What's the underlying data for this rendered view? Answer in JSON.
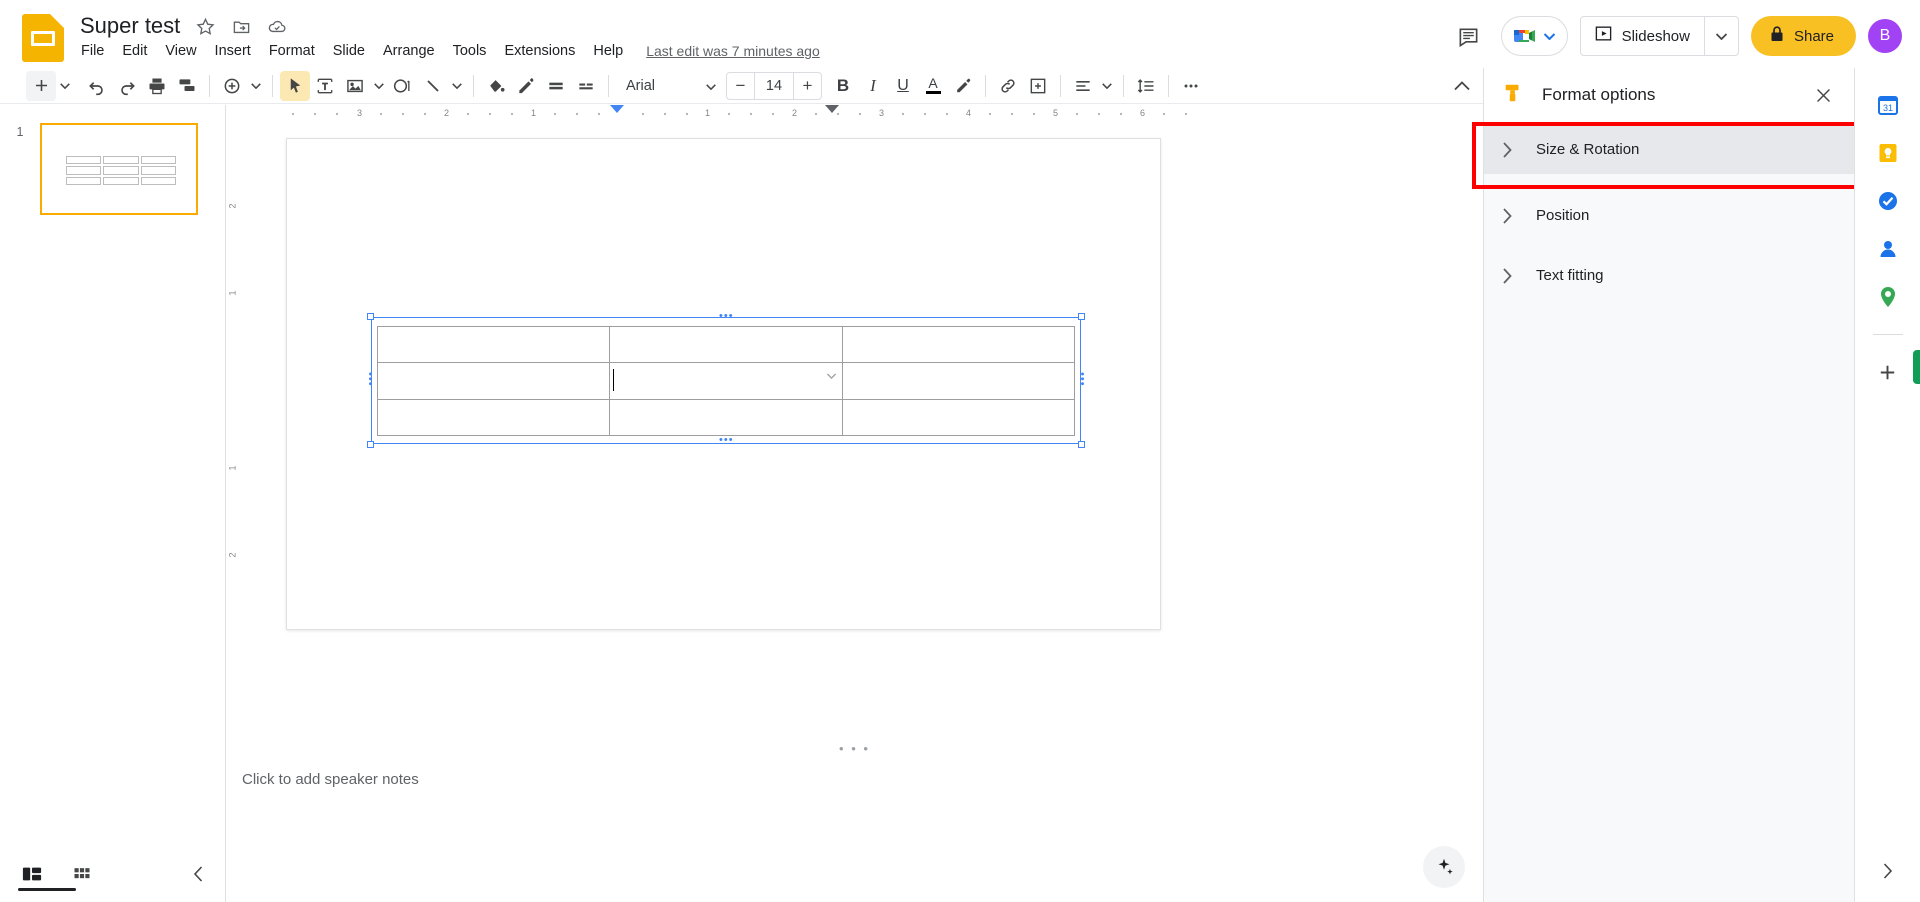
{
  "app": {
    "logo_icon": "slides-logo-icon",
    "title": "Super test",
    "title_icons": [
      "star-icon",
      "move-to-folder-icon",
      "cloud-saved-icon"
    ],
    "last_edit": "Last edit was 7 minutes ago"
  },
  "menubar": {
    "items": [
      {
        "label": "File"
      },
      {
        "label": "Edit"
      },
      {
        "label": "View"
      },
      {
        "label": "Insert"
      },
      {
        "label": "Format"
      },
      {
        "label": "Slide"
      },
      {
        "label": "Arrange"
      },
      {
        "label": "Tools"
      },
      {
        "label": "Extensions"
      },
      {
        "label": "Help"
      }
    ]
  },
  "top_right": {
    "comment_history_icon": "comment-history-icon",
    "meet_icon": "google-meet-icon",
    "meet_caret": "chevron-down-icon",
    "slideshow_icon": "present-icon",
    "slideshow_label": "Slideshow",
    "slideshow_caret": "chevron-down-icon",
    "share_icon": "lock-icon",
    "share_label": "Share",
    "avatar_initial": "B",
    "avatar_color": "#a142f4",
    "share_color": "#f9c024"
  },
  "toolbar": {
    "items": [
      {
        "name": "new-slide-button",
        "icon": "plus-icon"
      },
      {
        "name": "new-slide-dropdown",
        "icon": "chevron-down-icon"
      },
      {
        "name": "undo-button",
        "icon": "undo-icon"
      },
      {
        "name": "redo-button",
        "icon": "redo-icon"
      },
      {
        "name": "print-button",
        "icon": "print-icon"
      },
      {
        "name": "paint-format-button",
        "icon": "paint-format-icon"
      },
      {
        "name": "zoom-button",
        "icon": "zoom-icon"
      },
      {
        "name": "zoom-dropdown",
        "icon": "chevron-down-icon"
      },
      {
        "name": "select-tool-button",
        "icon": "cursor-icon"
      },
      {
        "name": "text-box-button",
        "icon": "text-box-icon"
      },
      {
        "name": "insert-image-button",
        "icon": "image-icon"
      },
      {
        "name": "insert-image-dropdown",
        "icon": "chevron-down-icon"
      },
      {
        "name": "shape-button",
        "icon": "shape-icon"
      },
      {
        "name": "line-button",
        "icon": "line-icon"
      },
      {
        "name": "line-dropdown",
        "icon": "chevron-down-icon"
      },
      {
        "name": "fill-color-button",
        "icon": "fill-color-icon"
      },
      {
        "name": "border-color-button",
        "icon": "pencil-icon"
      },
      {
        "name": "border-weight-button",
        "icon": "border-weight-icon"
      },
      {
        "name": "border-dash-button",
        "icon": "border-dash-icon"
      },
      {
        "name": "bold-button",
        "icon": "bold-icon",
        "label": "B"
      },
      {
        "name": "italic-button",
        "icon": "italic-icon",
        "label": "I"
      },
      {
        "name": "underline-button",
        "icon": "underline-icon",
        "label": "U"
      },
      {
        "name": "text-color-button",
        "icon": "text-color-icon",
        "label": "A"
      },
      {
        "name": "highlight-color-button",
        "icon": "highlight-icon"
      },
      {
        "name": "insert-link-button",
        "icon": "link-icon"
      },
      {
        "name": "add-comment-button",
        "icon": "add-comment-icon"
      },
      {
        "name": "align-button",
        "icon": "align-icon"
      },
      {
        "name": "align-dropdown",
        "icon": "chevron-down-icon"
      },
      {
        "name": "line-spacing-button",
        "icon": "line-spacing-icon"
      },
      {
        "name": "more-options-button",
        "icon": "more-horizontal-icon"
      },
      {
        "name": "collapse-toolbar-button",
        "icon": "chevron-up-icon"
      }
    ],
    "font_name": "Arial",
    "font_dropdown_icon": "chevron-down-icon",
    "font_size_decrease": "−",
    "font_size": "14",
    "font_size_increase": "+"
  },
  "filmstrip": {
    "slides": [
      {
        "number": "1",
        "selected": true,
        "content": "table-3x3"
      }
    ],
    "footer": {
      "filmstrip_view_icon": "filmstrip-view-icon",
      "grid_view_icon": "grid-view-icon",
      "collapse_icon": "chevron-left-icon"
    }
  },
  "canvas": {
    "ruler_h_labels": [
      "3",
      "2",
      "1",
      "1",
      "2",
      "3",
      "4",
      "5",
      "6"
    ],
    "ruler_v_labels": [
      "2",
      "1",
      "1",
      "2"
    ],
    "table": {
      "rows": 3,
      "cols": 3,
      "cells": [
        [
          "",
          "",
          ""
        ],
        [
          "",
          "",
          ""
        ],
        [
          "",
          "",
          ""
        ]
      ],
      "cursor_cell": {
        "row": 1,
        "col": 1
      },
      "cell_menu_icon": "chevron-down-icon"
    },
    "selection": {
      "handle_icon": "resize-handle",
      "top_dots": "•••",
      "bottom_dots": "•••"
    }
  },
  "notes": {
    "drag_handle": "• • •",
    "placeholder": "Click to add speaker notes",
    "explore_icon": "explore-icon"
  },
  "format_panel": {
    "panel_icon": "format-options-icon",
    "title": "Format options",
    "close_icon": "close-icon",
    "sections": [
      {
        "label": "Size & Rotation",
        "icon": "chevron-right-icon",
        "selected": true
      },
      {
        "label": "Position",
        "icon": "chevron-right-icon",
        "selected": false
      },
      {
        "label": "Text fitting",
        "icon": "chevron-right-icon",
        "selected": false
      }
    ],
    "highlight_color": "#ff0000"
  },
  "right_rail": {
    "icons": [
      {
        "name": "google-calendar-icon"
      },
      {
        "name": "google-keep-icon"
      },
      {
        "name": "google-tasks-icon"
      },
      {
        "name": "google-contacts-icon"
      },
      {
        "name": "google-maps-icon"
      },
      {
        "name": "add-on-icon"
      }
    ],
    "expand_icon": "chevron-right-icon"
  }
}
